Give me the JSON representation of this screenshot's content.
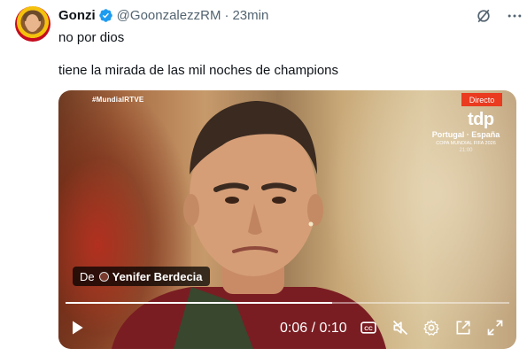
{
  "tweet": {
    "author_name": "Gonzi",
    "handle": "@GoonzalezzRM",
    "separator": "·",
    "time": "23min",
    "text_line1": "no por dios",
    "text_line2": "tiene la mirada de las mil noches de champions"
  },
  "video": {
    "broadcast_tag": "#MundialRTVE",
    "live_badge": "Directo",
    "channel_logo": "tdp",
    "match": "Portugal · España",
    "competition": "COPA MUNDIAL FIFA 2026",
    "kickoff": "21:00",
    "credit_prefix": "De",
    "credit_name": "Yenifer Berdecia",
    "current_time": "0:06",
    "time_sep": " / ",
    "duration": "0:10",
    "progress_fraction": 0.6
  },
  "icons": {
    "verified": "verified-badge-icon",
    "grok": "grok-icon",
    "more": "more-icon",
    "play": "play-icon",
    "captions": "captions-icon",
    "mute": "mute-icon",
    "settings": "gear-icon",
    "pip": "picture-in-picture-icon",
    "fullscreen": "fullscreen-icon"
  },
  "colors": {
    "accent": "#1d9bf0",
    "live": "#ea3a1f",
    "text_primary": "#0f1419",
    "text_secondary": "#536471"
  }
}
